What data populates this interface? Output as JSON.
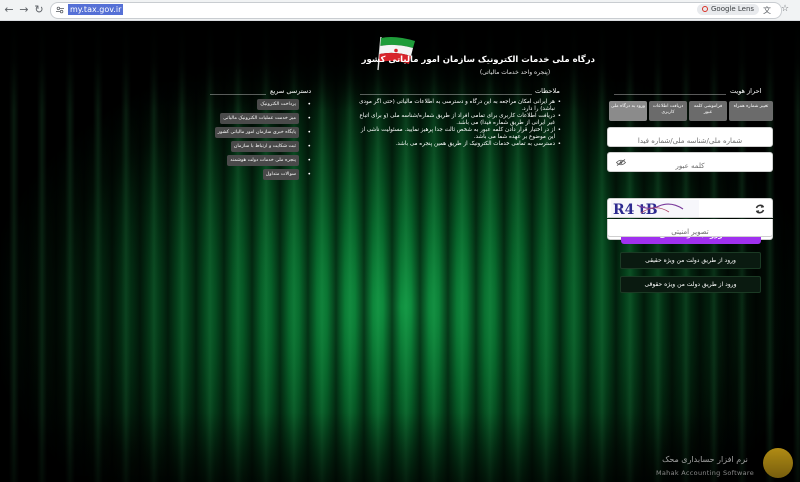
{
  "browser": {
    "url": "my.tax.gov.ir",
    "lens_label": "Google Lens"
  },
  "header": {
    "title": "درگاه ملی خدمات الکترونیک سازمان امور مالیاتی کشور",
    "subtitle": "(پنجره واحد خدمات مالیاتی)"
  },
  "auth": {
    "heading": "احراز هویت",
    "tabs": [
      "ورود به درگاه ملی",
      "دریافت اطلاعات کاربری",
      "فراموشی کلمه عبور",
      "تغییر شماره همراه"
    ],
    "username_placeholder": "شماره ملی/شناسه ملی/شماره فیدا",
    "password_placeholder": "کلمه عبور",
    "captcha_text": "R4 tB",
    "captcha_placeholder": "تصویر امنیتی",
    "login_button": "ورود به درگاه ملی",
    "alt_buttons": [
      "ورود از طریق دولت من ویژه حقیقی",
      "ورود از طریق دولت من ویژه حقوقی"
    ]
  },
  "notices": {
    "heading": "ملاحظات",
    "items": [
      "هر ایرانی امکان مراجعه به این درگاه و دسترسی به اطلاعات مالیاتی (حتی اگر مودی نباشد) را دارد.",
      "دریافت اطلاعات کاربری برای تمامی افراد از طریق شماره/شناسه ملی (و برای اتباع غیر ایرانی از طریق شماره فیدا) می باشد.",
      "از در اختیار قرار دادن کلمه عبور به شخص ثالث جدا پرهیز نمایید. مسئولیت ناشی از این موضوع بر عهده شما می باشد.",
      "دسترسی به تمامی خدمات الکترونیک از طریق همین پنجره می باشد."
    ]
  },
  "quick_access": {
    "heading": "دسترسی سریع",
    "links": [
      "پرداخت الکترونیک",
      "میز خدمت عملیات الکترونیک مالیاتی",
      "پایگاه خبری سازمان امور مالیاتی کشور",
      "ثبت شکایت و ارتباط با سازمان",
      "پنجره ملی خدمات دولت هوشمند",
      "سوالات متداول"
    ]
  },
  "logo": {
    "fa": "نرم افزار حسابداری محک",
    "en": "Mahak Accounting Software"
  },
  "colors": {
    "primary_button": "#a031ef",
    "background_green": "#0f8f3f",
    "logo_yellow": "#f6c21c"
  }
}
